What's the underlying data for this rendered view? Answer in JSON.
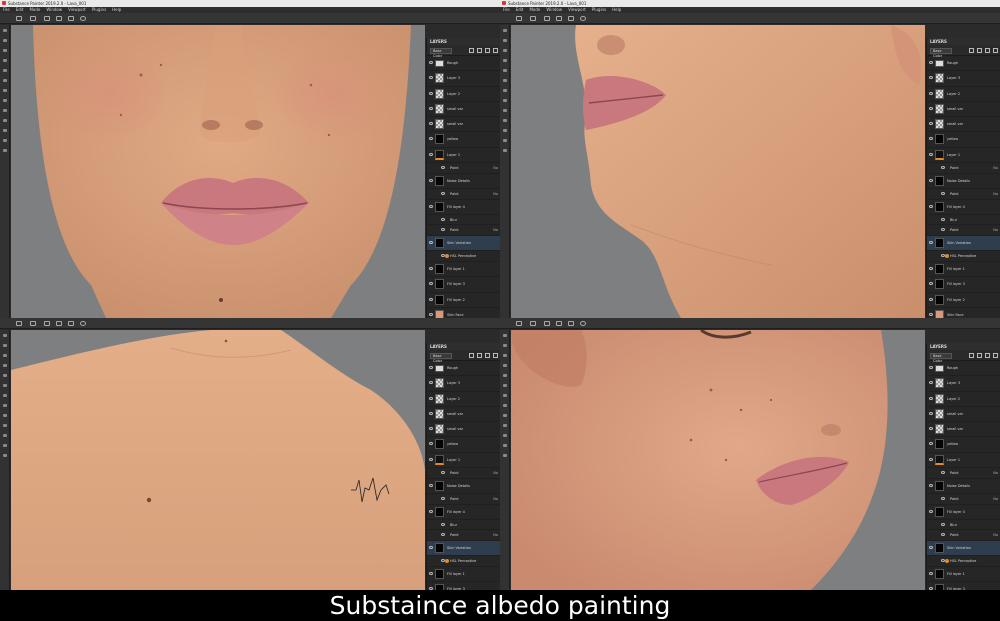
{
  "app": {
    "title": "Substance Painter 2019.2.0 - Lava_001",
    "menu": [
      "File",
      "Edit",
      "Mode",
      "Window",
      "Viewport",
      "Plugins",
      "Help"
    ]
  },
  "layers_panel": {
    "heading": "LAYERS",
    "channel": "Base Color",
    "rows": [
      {
        "name": "Rough",
        "thumb": "folder",
        "type": "layer"
      },
      {
        "name": "Layer 3",
        "thumb": "check",
        "type": "layer"
      },
      {
        "name": "Layer 2",
        "thumb": "check",
        "type": "layer"
      },
      {
        "name": "small var",
        "thumb": "check",
        "type": "layer"
      },
      {
        "name": "small var",
        "thumb": "check",
        "type": "layer"
      },
      {
        "name": "yellow",
        "thumb": "black",
        "type": "layer"
      },
      {
        "name": "Layer 1",
        "thumb": "orange",
        "type": "layer"
      },
      {
        "name": "Paint",
        "thumb": "",
        "type": "effect",
        "mark": "No"
      },
      {
        "name": "Noise Details",
        "thumb": "black",
        "type": "layer"
      },
      {
        "name": "Paint",
        "thumb": "",
        "type": "effect",
        "mark": "No"
      },
      {
        "name": "Fill layer 4",
        "thumb": "black",
        "type": "layer"
      },
      {
        "name": "Blur",
        "thumb": "",
        "type": "effect"
      },
      {
        "name": "Paint",
        "thumb": "",
        "type": "effect",
        "mark": "No"
      },
      {
        "name": "Skin Variation",
        "thumb": "black",
        "type": "layer",
        "selected": true
      },
      {
        "name": "HSL Perceptive",
        "thumb": "",
        "type": "effect",
        "dot": true
      },
      {
        "name": "Fill layer 1",
        "thumb": "black",
        "type": "layer"
      },
      {
        "name": "Fill layer 3",
        "thumb": "black",
        "type": "layer"
      },
      {
        "name": "Fill layer 2",
        "thumb": "black",
        "type": "layer"
      },
      {
        "name": "Skin Face",
        "thumb": "skin",
        "type": "layer"
      }
    ]
  },
  "caption": "Substaince albedo painting",
  "colors": {
    "viewport_bg": "#7e7f80",
    "skin": "#d9a27d",
    "lips": "#c9787e",
    "accent": "#e08a2a",
    "selection": "#2f3e4e"
  }
}
